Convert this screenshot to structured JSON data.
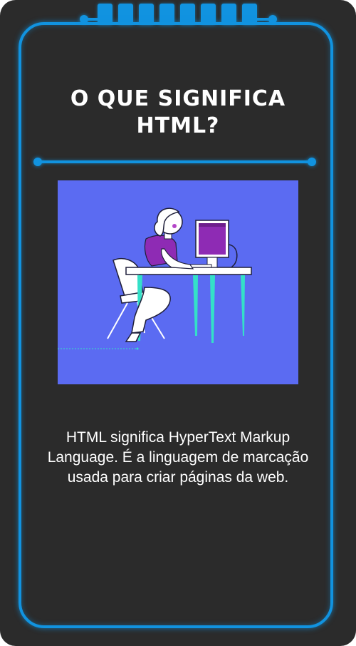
{
  "card": {
    "title": "O QUE SIGNIFICA HTML?",
    "description": "HTML significa HyperText Markup Language. É a linguagem de marcação usada para criar páginas da web."
  },
  "illustration": {
    "icon": "person-at-computer-illustration"
  },
  "colors": {
    "card_background": "#2b2b2b",
    "accent": "#1193e0",
    "illustration_background": "#5b6bf2",
    "text": "#ffffff"
  }
}
